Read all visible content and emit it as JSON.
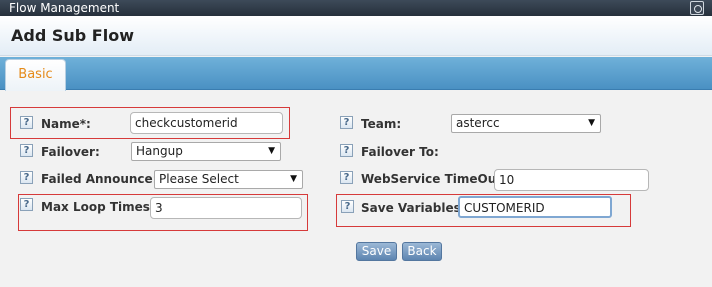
{
  "window": {
    "title": "Flow Management"
  },
  "header": {
    "title": "Add Sub Flow"
  },
  "tabs": [
    {
      "label": "Basic"
    }
  ],
  "help_glyph": "?",
  "form": {
    "name": {
      "label": "Name*:",
      "value": "checkcustomerid"
    },
    "team": {
      "label": "Team:",
      "value": "astercc"
    },
    "failover": {
      "label": "Failover:",
      "value": "Hangup"
    },
    "failover_to": {
      "label": "Failover To:"
    },
    "failed_announce": {
      "label": "Failed Announce:",
      "value": "Please Select"
    },
    "webservice_timeout": {
      "label": "WebService TimeOut:",
      "value": "10"
    },
    "max_loop_times": {
      "label": "Max Loop Times:",
      "value": "3"
    },
    "save_variables": {
      "label": "Save Variables:",
      "value": "CUSTOMERID"
    }
  },
  "buttons": {
    "save": "Save",
    "back": "Back"
  },
  "dropdown_arrow": "▼",
  "colors": {
    "tab_bar": "#4a91c3",
    "tab_text": "#e58b1a",
    "highlight_border": "#d63a3a",
    "button": "#5d84b0"
  }
}
